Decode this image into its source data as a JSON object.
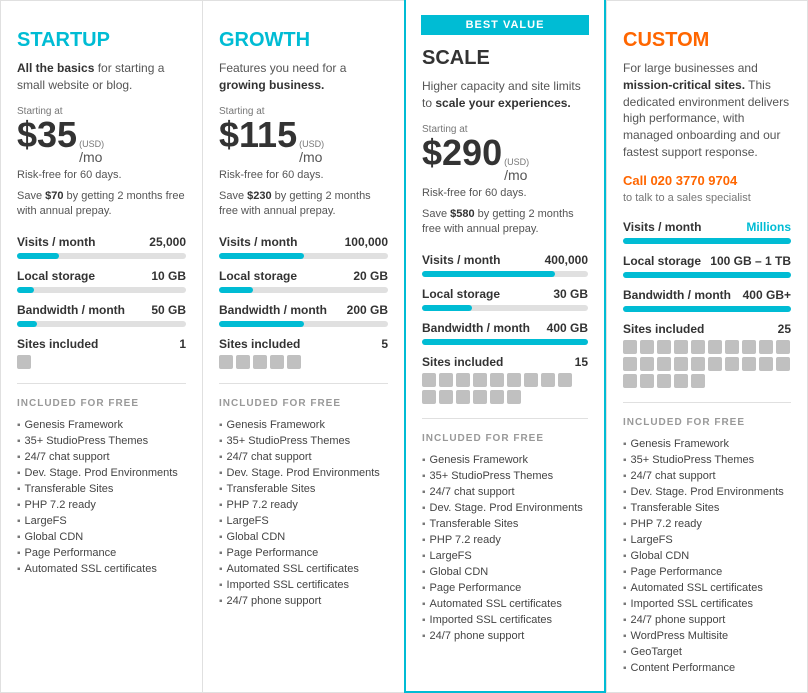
{
  "plans": [
    {
      "id": "startup",
      "titleClass": "startup",
      "title": "STARTUP",
      "desc": "<strong>All the basics</strong> for starting a small website or blog.",
      "startingAt": "Starting at",
      "usd": "(USD)",
      "price": "$35",
      "mo": "/mo",
      "riskFree": "Risk-free for 60 days.",
      "save": "Save <strong>$70</strong> by getting 2 months free with annual prepay.",
      "bestValue": false,
      "callText": "",
      "callSub": "",
      "metrics": [
        {
          "label": "Visits / month",
          "value": "25,000",
          "valueTeal": false,
          "fill": 25
        },
        {
          "label": "Local storage",
          "value": "10 GB",
          "valueTeal": false,
          "fill": 10
        },
        {
          "label": "Bandwidth / month",
          "value": "50 GB",
          "valueTeal": false,
          "fill": 12
        }
      ],
      "sitesLabel": "Sites included",
      "sitesValue": "1",
      "sitesCount": 1,
      "includedTitle": "INCLUDED FOR FREE",
      "features": [
        "Genesis Framework",
        "35+ StudioPress Themes",
        "24/7 chat support",
        "Dev. Stage. Prod Environments",
        "Transferable Sites",
        "PHP 7.2 ready",
        "LargeFS",
        "Global CDN",
        "Page Performance",
        "Automated SSL certificates"
      ]
    },
    {
      "id": "growth",
      "titleClass": "growth",
      "title": "GROWTH",
      "desc": "Features you need for a <strong>growing business.</strong>",
      "startingAt": "Starting at",
      "usd": "(USD)",
      "price": "$115",
      "mo": "/mo",
      "riskFree": "Risk-free for 60 days.",
      "save": "Save <strong>$230</strong> by getting 2 months free with annual prepay.",
      "bestValue": false,
      "callText": "",
      "callSub": "",
      "metrics": [
        {
          "label": "Visits / month",
          "value": "100,000",
          "valueTeal": false,
          "fill": 50
        },
        {
          "label": "Local storage",
          "value": "20 GB",
          "valueTeal": false,
          "fill": 20
        },
        {
          "label": "Bandwidth / month",
          "value": "200 GB",
          "valueTeal": false,
          "fill": 50
        }
      ],
      "sitesLabel": "Sites included",
      "sitesValue": "5",
      "sitesCount": 5,
      "includedTitle": "INCLUDED FOR FREE",
      "features": [
        "Genesis Framework",
        "35+ StudioPress Themes",
        "24/7 chat support",
        "Dev. Stage. Prod Environments",
        "Transferable Sites",
        "PHP 7.2 ready",
        "LargeFS",
        "Global CDN",
        "Page Performance",
        "Automated SSL certificates",
        "Imported SSL certificates",
        "24/7 phone support"
      ]
    },
    {
      "id": "scale",
      "titleClass": "scale",
      "title": "SCALE",
      "desc": "Higher capacity and site limits to <strong>scale your experiences.</strong>",
      "startingAt": "Starting at",
      "usd": "(USD)",
      "price": "$290",
      "mo": "/mo",
      "riskFree": "Risk-free for 60 days.",
      "save": "Save <strong>$580</strong> by getting 2 months free with annual prepay.",
      "bestValue": true,
      "callText": "",
      "callSub": "",
      "metrics": [
        {
          "label": "Visits / month",
          "value": "400,000",
          "valueTeal": false,
          "fill": 80
        },
        {
          "label": "Local storage",
          "value": "30 GB",
          "valueTeal": false,
          "fill": 30
        },
        {
          "label": "Bandwidth / month",
          "value": "400 GB",
          "valueTeal": false,
          "fill": 100
        }
      ],
      "sitesLabel": "Sites included",
      "sitesValue": "15",
      "sitesCount": 15,
      "includedTitle": "INCLUDED FOR FREE",
      "features": [
        "Genesis Framework",
        "35+ StudioPress Themes",
        "24/7 chat support",
        "Dev. Stage. Prod Environments",
        "Transferable Sites",
        "PHP 7.2 ready",
        "LargeFS",
        "Global CDN",
        "Page Performance",
        "Automated SSL certificates",
        "Imported SSL certificates",
        "24/7 phone support"
      ]
    },
    {
      "id": "custom",
      "titleClass": "custom",
      "title": "CUSTOM",
      "desc": "For large businesses and <strong>mission-critical sites.</strong> This dedicated environment delivers high performance, with managed onboarding and our fastest support response.",
      "startingAt": "",
      "usd": "",
      "price": "",
      "mo": "",
      "riskFree": "",
      "save": "",
      "bestValue": false,
      "callText": "Call 020 3770 9704",
      "callSub": "to talk to a sales specialist",
      "metrics": [
        {
          "label": "Visits / month",
          "value": "Millions",
          "valueTeal": true,
          "fill": 100
        },
        {
          "label": "Local storage",
          "value": "100 GB – 1 TB",
          "valueTeal": false,
          "fill": 100
        },
        {
          "label": "Bandwidth / month",
          "value": "400 GB+",
          "valueTeal": false,
          "fill": 100
        }
      ],
      "sitesLabel": "Sites included",
      "sitesValue": "25",
      "sitesCount": 25,
      "includedTitle": "INCLUDED FOR FREE",
      "features": [
        "Genesis Framework",
        "35+ StudioPress Themes",
        "24/7 chat support",
        "Dev. Stage. Prod Environments",
        "Transferable Sites",
        "PHP 7.2 ready",
        "LargeFS",
        "Global CDN",
        "Page Performance",
        "Automated SSL certificates",
        "Imported SSL certificates",
        "24/7 phone support",
        "WordPress Multisite",
        "GeoTarget",
        "Content Performance"
      ]
    }
  ]
}
